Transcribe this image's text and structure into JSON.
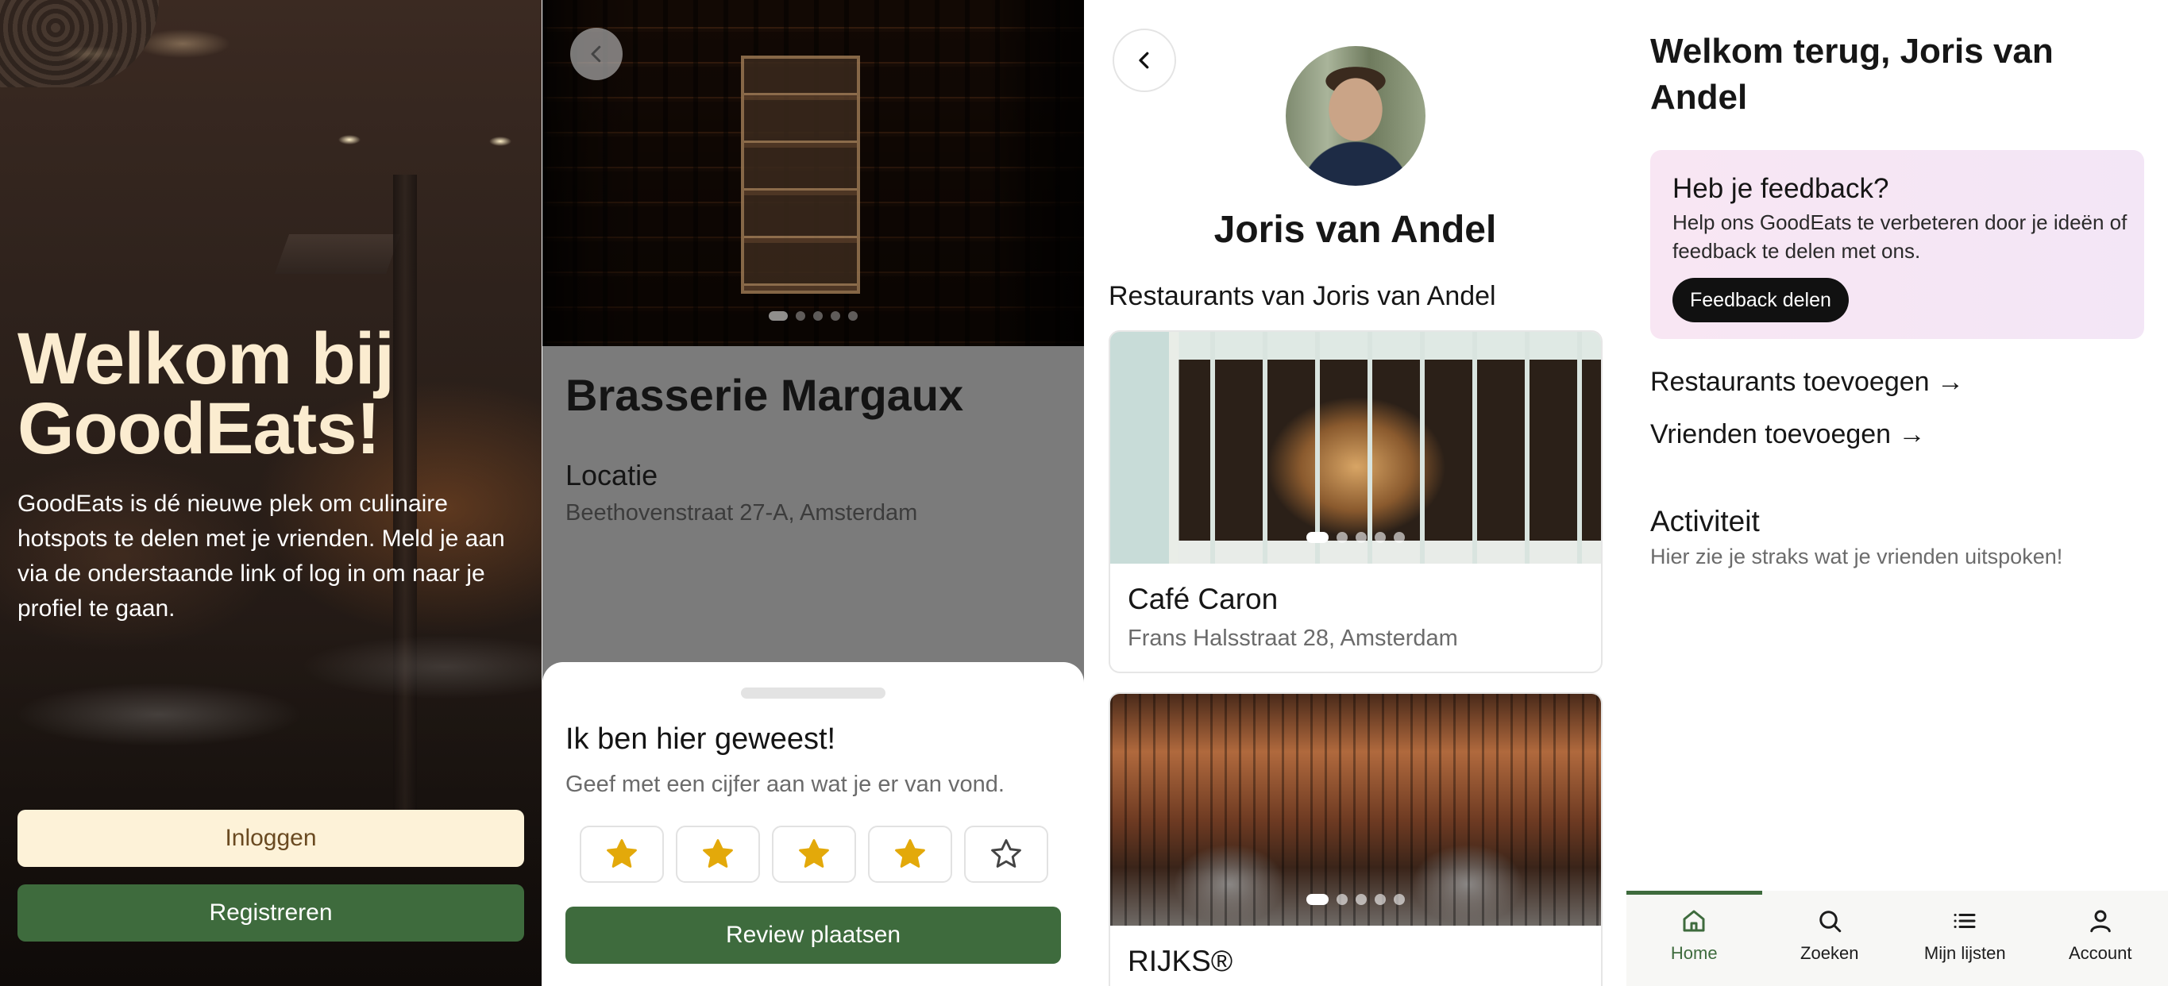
{
  "welcome_screen": {
    "title": "Welkom bij GoodEats!",
    "intro": "GoodEats is dé nieuwe plek om culinaire hotspots te delen met je vrienden. Meld je aan via de onderstaande link of log in om naar je profiel te gaan.",
    "login_label": "Inloggen",
    "register_label": "Registreren"
  },
  "restaurant_screen": {
    "name": "Brasserie Margaux",
    "location_label": "Locatie",
    "location_value": "Beethovenstraat 27-A, Amsterdam",
    "photo_pages": 5,
    "photo_current": 1,
    "rating_sheet": {
      "title": "Ik ben hier geweest!",
      "subtitle": "Geef met een cijfer aan wat je er van vond.",
      "rating": 4,
      "max_rating": 5,
      "submit_label": "Review plaatsen"
    }
  },
  "profile_screen": {
    "name": "Joris van Andel",
    "section_title": "Restaurants van Joris van Andel",
    "restaurants": [
      {
        "name": "Café Caron",
        "address": "Frans Halsstraat 28, Amsterdam",
        "photo_pages": 5,
        "photo_current": 1
      },
      {
        "name": "RIJKS®",
        "address": "",
        "photo_pages": 5,
        "photo_current": 1
      }
    ]
  },
  "home_screen": {
    "welcome": "Welkom terug, Joris van Andel",
    "feedback": {
      "title": "Heb je feedback?",
      "text": "Help ons GoodEats te verbeteren door je ideën of feedback te delen met ons.",
      "button": "Feedback delen"
    },
    "links": [
      "Restaurants toevoegen →",
      "Vrienden toevoegen →"
    ],
    "activity_title": "Activiteit",
    "activity_text": "Hier zie je straks wat je vrienden uitspoken!",
    "tabs": [
      {
        "label": "Home",
        "icon": "home-icon",
        "active": true
      },
      {
        "label": "Zoeken",
        "icon": "search-icon",
        "active": false
      },
      {
        "label": "Mijn lijsten",
        "icon": "list-icon",
        "active": false
      },
      {
        "label": "Account",
        "icon": "user-icon",
        "active": false
      }
    ]
  },
  "colors": {
    "brand_green": "#3e6b3d",
    "cream": "#fdf2d8",
    "star_gold": "#e3a90a",
    "feedback_bg": "#f6e6f4"
  }
}
